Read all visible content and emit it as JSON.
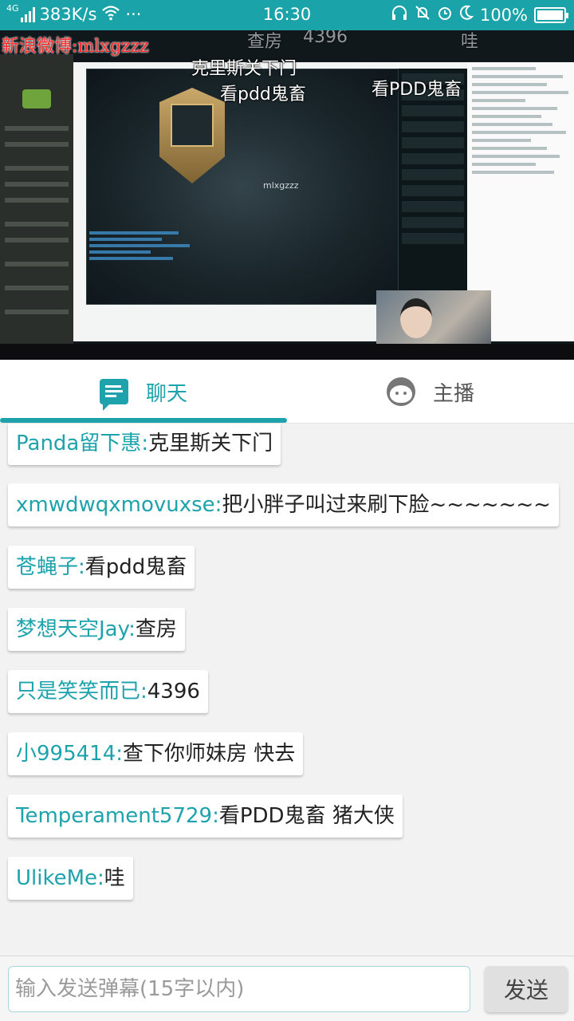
{
  "status_bar": {
    "network_type": "4G",
    "net_speed": "383K/s",
    "more": "···",
    "time": "16:30",
    "battery_percent": "100%",
    "icons": [
      "signal-icon",
      "wifi-icon",
      "headset-icon",
      "bell-muted-icon",
      "alarm-icon",
      "moon-icon",
      "battery-icon"
    ],
    "color": "#1aa3a8"
  },
  "video": {
    "overlay_top": "新浪微博:mlxgzzz",
    "player_name": "mlxgzzz",
    "danmaku": [
      {
        "text": "克里斯关下门"
      },
      {
        "text": "看pdd鬼畜"
      },
      {
        "text": "看PDD鬼畜"
      },
      {
        "text": "查房"
      },
      {
        "text": "4396"
      },
      {
        "text": "哇"
      }
    ]
  },
  "tabs": [
    {
      "label": "聊天",
      "icon": "chat-bubble-icon",
      "active": true
    },
    {
      "label": "主播",
      "icon": "streamer-face-icon",
      "active": false
    }
  ],
  "accent_color": "#1ea3ac",
  "messages": [
    {
      "user": "Panda留下惠:",
      "text": "克里斯关下门"
    },
    {
      "user": "xmwdwqxmovuxse:",
      "text": "把小胖子叫过来刷下脸~~~~~~~"
    },
    {
      "user": "苍蝇子:",
      "text": "看pdd鬼畜"
    },
    {
      "user": "梦想天空Jay:",
      "text": "查房"
    },
    {
      "user": "只是笑笑而已:",
      "text": "4396"
    },
    {
      "user": "小995414:",
      "text": "查下你师妹房  快去"
    },
    {
      "user": "Temperament5729:",
      "text": "看PDD鬼畜 猪大侠"
    },
    {
      "user": "UlikeMe:",
      "text": "哇"
    }
  ],
  "input": {
    "placeholder": "输入发送弹幕(15字以内)",
    "value": "",
    "send_label": "发送"
  }
}
